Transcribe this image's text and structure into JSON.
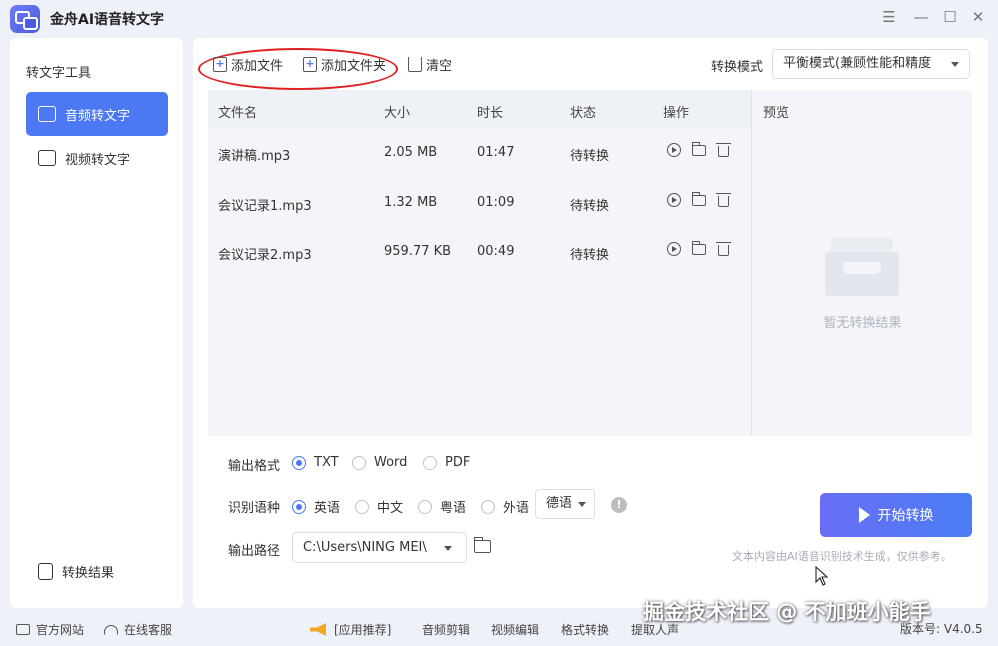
{
  "window": {
    "title": "金舟AI语音转文字"
  },
  "sidebar": {
    "title": "转文字工具",
    "items": [
      {
        "label": "音频转文字",
        "active": true,
        "icon": "audio-to-text-icon"
      },
      {
        "label": "视频转文字",
        "active": false,
        "icon": "video-to-text-icon"
      }
    ],
    "results_label": "转换结果"
  },
  "toolbar": {
    "add_file": "添加文件",
    "add_folder": "添加文件夹",
    "clear": "清空",
    "mode_label": "转换模式",
    "mode_value": "平衡模式(兼顾性能和精度"
  },
  "table": {
    "headers": [
      "文件名",
      "大小",
      "时长",
      "状态",
      "操作"
    ],
    "rows": [
      {
        "name": "演讲稿.mp3",
        "size": "2.05 MB",
        "duration": "01:47",
        "status": "待转换"
      },
      {
        "name": "会议记录1.mp3",
        "size": "1.32 MB",
        "duration": "01:09",
        "status": "待转换"
      },
      {
        "name": "会议记录2.mp3",
        "size": "959.77 KB",
        "duration": "00:49",
        "status": "待转换"
      }
    ]
  },
  "preview": {
    "title": "预览",
    "empty_text": "暂无转换结果"
  },
  "options": {
    "format_label": "输出格式",
    "formats": [
      {
        "label": "TXT",
        "selected": true
      },
      {
        "label": "Word",
        "selected": false
      },
      {
        "label": "PDF",
        "selected": false
      }
    ],
    "lang_label": "识别语种",
    "languages": [
      {
        "label": "英语",
        "selected": true
      },
      {
        "label": "中文",
        "selected": false
      },
      {
        "label": "粤语",
        "selected": false
      },
      {
        "label": "外语",
        "selected": false
      }
    ],
    "foreign_lang_value": "德语",
    "path_label": "输出路径",
    "path_value": "C:\\Users\\NING MEI\\"
  },
  "actions": {
    "start": "开始转换",
    "disclaimer": "文本内容由AI语音识别技术生成，仅供参考。"
  },
  "statusbar": {
    "website": "官方网站",
    "support": "在线客服",
    "recommend": "[应用推荐]",
    "links": [
      "音频剪辑",
      "视频编辑",
      "格式转换",
      "提取人声"
    ],
    "version": "版本号: V4.0.5"
  },
  "watermark": "掘金技术社区 @ 不加班小能手",
  "colors": {
    "accent": "#4d78f4",
    "highlight_ellipse": "#e02020"
  }
}
